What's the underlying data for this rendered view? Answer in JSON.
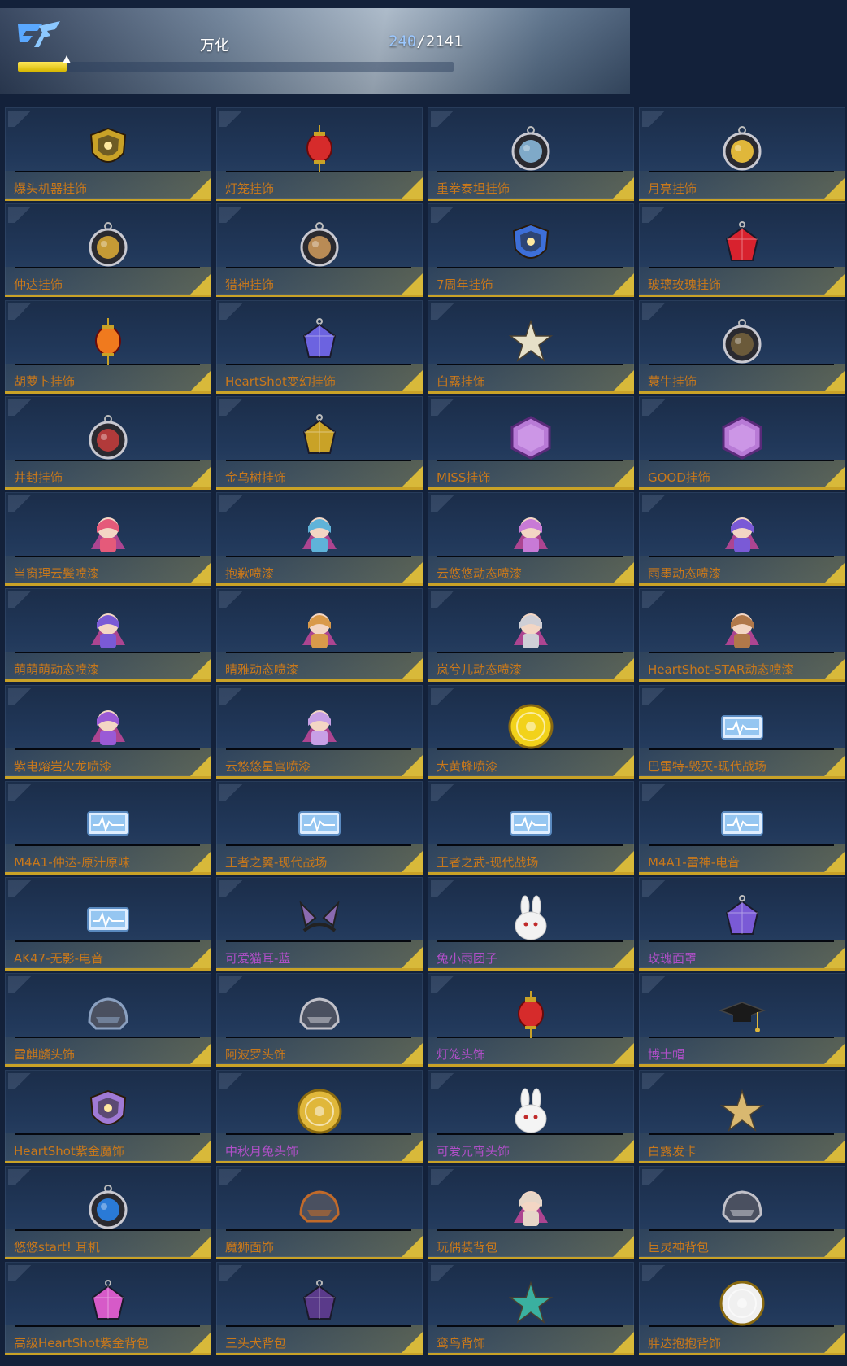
{
  "header": {
    "nickname": "万化",
    "progress_current": "240",
    "progress_separator": "/",
    "progress_total": "2141",
    "progress_fraction": 0.112
  },
  "items": [
    {
      "label": "爆头机器挂饰",
      "icon": "robot-head-charm-icon",
      "color": "#c9a227",
      "shape": "shield",
      "rarity": "orange"
    },
    {
      "label": "灯笼挂饰",
      "icon": "lantern-charm-icon",
      "color": "#d62b2b",
      "shape": "lantern",
      "rarity": "orange"
    },
    {
      "label": "重拳泰坦挂饰",
      "icon": "titan-fist-charm-icon",
      "color": "#7fa9c8",
      "shape": "ring",
      "rarity": "orange"
    },
    {
      "label": "月亮挂饰",
      "icon": "moon-charm-icon",
      "color": "#e0b73a",
      "shape": "ring",
      "rarity": "orange"
    },
    {
      "label": "仲达挂饰",
      "icon": "zhongda-charm-icon",
      "color": "#c59a35",
      "shape": "ring",
      "rarity": "orange"
    },
    {
      "label": "猎神挂饰",
      "icon": "hunter-god-charm-icon",
      "color": "#b98b55",
      "shape": "ring",
      "rarity": "orange"
    },
    {
      "label": "7周年挂饰",
      "icon": "anniversary-7-charm-icon",
      "color": "#3d6fd8",
      "shape": "shield",
      "rarity": "orange"
    },
    {
      "label": "玻璃玫瑰挂饰",
      "icon": "glass-rose-charm-icon",
      "color": "#d8222e",
      "shape": "gem",
      "rarity": "orange"
    },
    {
      "label": "胡萝卜挂饰",
      "icon": "carrot-charm-icon",
      "color": "#f07a1e",
      "shape": "lantern",
      "rarity": "orange"
    },
    {
      "label": "HeartShot变幻挂饰",
      "icon": "heartshot-crystal-charm-icon",
      "color": "#6c63e0",
      "shape": "gem",
      "rarity": "orange"
    },
    {
      "label": "白露挂饰",
      "icon": "bailu-charm-icon",
      "color": "#e6e0c8",
      "shape": "star",
      "rarity": "orange"
    },
    {
      "label": "蓑牛挂饰",
      "icon": "ox-charm-icon",
      "color": "#6b5a3a",
      "shape": "ring",
      "rarity": "orange"
    },
    {
      "label": "井封挂饰",
      "icon": "sealed-well-charm-icon",
      "color": "#b23a3a",
      "shape": "ring",
      "rarity": "orange"
    },
    {
      "label": "金乌树挂饰",
      "icon": "golden-crow-tree-charm-icon",
      "color": "#c9a227",
      "shape": "gem",
      "rarity": "orange"
    },
    {
      "label": "MISS挂饰",
      "icon": "miss-badge-charm-icon",
      "color": "#b87ad6",
      "shape": "hex",
      "rarity": "orange"
    },
    {
      "label": "GOOD挂饰",
      "icon": "good-badge-charm-icon",
      "color": "#b87ad6",
      "shape": "hex",
      "rarity": "orange"
    },
    {
      "label": "当窗理云鬓喷漆",
      "icon": "girl-cloud-spray-icon",
      "color": "#e55a7a",
      "shape": "portrait",
      "rarity": "orange"
    },
    {
      "label": "抱歉喷漆",
      "icon": "sorry-spray-icon",
      "color": "#5fb3d9",
      "shape": "portrait",
      "rarity": "orange"
    },
    {
      "label": "云悠悠动态喷漆",
      "icon": "yunyouyou-spray-icon",
      "color": "#c87ad6",
      "shape": "portrait",
      "rarity": "orange"
    },
    {
      "label": "雨墨动态喷漆",
      "icon": "yumo-spray-icon",
      "color": "#7a5ad6",
      "shape": "portrait",
      "rarity": "orange"
    },
    {
      "label": "萌萌萌动态喷漆",
      "icon": "mengmeng-spray-icon",
      "color": "#7a5ad6",
      "shape": "portrait",
      "rarity": "orange"
    },
    {
      "label": "晴雅动态喷漆",
      "icon": "qingya-spray-icon",
      "color": "#d99a4a",
      "shape": "portrait",
      "rarity": "orange"
    },
    {
      "label": "岚兮儿动态喷漆",
      "icon": "lanxier-spray-icon",
      "color": "#cfcfd6",
      "shape": "portrait",
      "rarity": "orange"
    },
    {
      "label": "HeartShot-STAR动态喷漆",
      "icon": "heartshot-star-spray-icon",
      "color": "#b0784a",
      "shape": "portrait",
      "rarity": "orange"
    },
    {
      "label": "紫电熔岩火龙喷漆",
      "icon": "purple-lava-dragon-spray-icon",
      "color": "#9a5ad6",
      "shape": "portrait",
      "rarity": "orange"
    },
    {
      "label": "云悠悠星宫喷漆",
      "icon": "yunyouyou-star-spray-icon",
      "color": "#c8a0e6",
      "shape": "portrait",
      "rarity": "orange"
    },
    {
      "label": "大黄蜂喷漆",
      "icon": "bumblebee-spray-icon",
      "color": "#f2d21a",
      "shape": "coin",
      "rarity": "orange"
    },
    {
      "label": "巴雷特-毁灭-现代战场",
      "icon": "music-card-icon",
      "color": "#58a6e6",
      "shape": "card",
      "rarity": "orange"
    },
    {
      "label": "M4A1-仲达-原汁原味",
      "icon": "music-card-icon",
      "color": "#58a6e6",
      "shape": "card",
      "rarity": "orange"
    },
    {
      "label": "王者之翼-现代战场",
      "icon": "music-card-icon",
      "color": "#58a6e6",
      "shape": "card",
      "rarity": "orange"
    },
    {
      "label": "王者之武-现代战场",
      "icon": "music-card-icon",
      "color": "#58a6e6",
      "shape": "card",
      "rarity": "orange"
    },
    {
      "label": "M4A1-雷神-电音",
      "icon": "music-card-icon",
      "color": "#58a6e6",
      "shape": "card",
      "rarity": "orange"
    },
    {
      "label": "AK47-无影-电音",
      "icon": "music-card-icon",
      "color": "#58a6e6",
      "shape": "card",
      "rarity": "orange"
    },
    {
      "label": "可爱猫耳-蓝",
      "icon": "cat-ears-headband-icon",
      "color": "#8a6ab0",
      "shape": "ears",
      "rarity": "purple"
    },
    {
      "label": "兔小雨团子",
      "icon": "bunny-icon",
      "color": "#f2f2f2",
      "shape": "bunny",
      "rarity": "purple"
    },
    {
      "label": "玫瑰面罩",
      "icon": "rose-mask-icon",
      "color": "#7a5ad6",
      "shape": "gem",
      "rarity": "purple"
    },
    {
      "label": "雷麒麟头饰",
      "icon": "thunder-qilin-headgear-icon",
      "color": "#8aa0c0",
      "shape": "helmet",
      "rarity": "orange"
    },
    {
      "label": "阿波罗头饰",
      "icon": "apollo-headgear-icon",
      "color": "#c0c0c8",
      "shape": "helmet",
      "rarity": "orange"
    },
    {
      "label": "灯笼头饰",
      "icon": "lantern-headgear-icon",
      "color": "#d62b2b",
      "shape": "lantern",
      "rarity": "purple"
    },
    {
      "label": "博士帽",
      "icon": "graduation-cap-icon",
      "color": "#1a1a1a",
      "shape": "cap",
      "rarity": "purple"
    },
    {
      "label": "HeartShot紫金魔饰",
      "icon": "heartshot-purple-gold-icon",
      "color": "#a07ad6",
      "shape": "shield",
      "rarity": "orange"
    },
    {
      "label": "中秋月兔头饰",
      "icon": "mid-autumn-moon-rabbit-icon",
      "color": "#e0b73a",
      "shape": "coin",
      "rarity": "purple"
    },
    {
      "label": "可爱元宵头饰",
      "icon": "cute-yuanxiao-icon",
      "color": "#f4f4f4",
      "shape": "bunny",
      "rarity": "purple"
    },
    {
      "label": "白露发卡",
      "icon": "bailu-hairpin-icon",
      "color": "#d9b870",
      "shape": "star",
      "rarity": "orange"
    },
    {
      "label": "悠悠start! 耳机",
      "icon": "headphones-icon",
      "color": "#2a7ad6",
      "shape": "ring",
      "rarity": "orange"
    },
    {
      "label": "魔狮面饰",
      "icon": "magic-lion-mask-icon",
      "color": "#c06a2a",
      "shape": "helmet",
      "rarity": "orange"
    },
    {
      "label": "玩偶装背包",
      "icon": "doll-backpack-icon",
      "color": "#e6d6c8",
      "shape": "portrait",
      "rarity": "orange"
    },
    {
      "label": "巨灵神背包",
      "icon": "giant-god-backpack-icon",
      "color": "#c0c0c8",
      "shape": "helmet",
      "rarity": "orange"
    },
    {
      "label": "高级HeartShot紫金背包",
      "icon": "heartshot-purple-gold-backpack-icon",
      "color": "#d65ac8",
      "shape": "gem",
      "rarity": "orange"
    },
    {
      "label": "三头犬背包",
      "icon": "cerberus-backpack-icon",
      "color": "#5a3a8a",
      "shape": "gem",
      "rarity": "orange"
    },
    {
      "label": "鸾鸟背饰",
      "icon": "phoenix-back-ornament-icon",
      "color": "#3ab0a0",
      "shape": "star",
      "rarity": "orange"
    },
    {
      "label": "胖达抱抱背饰",
      "icon": "panda-hug-back-ornament-icon",
      "color": "#f0f0f0",
      "shape": "coin",
      "rarity": "orange"
    }
  ]
}
